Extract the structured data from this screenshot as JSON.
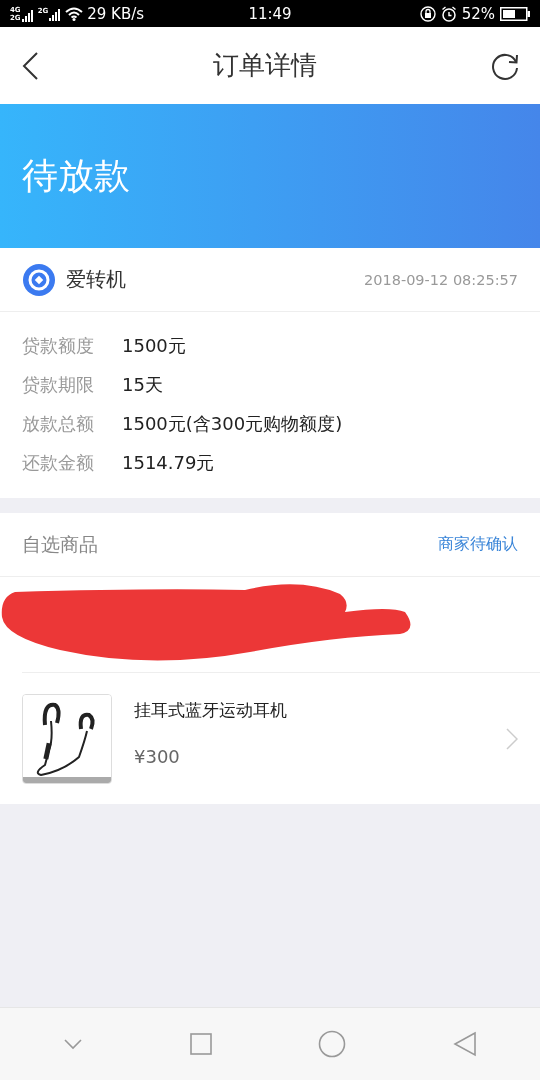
{
  "status_bar": {
    "network_labels": [
      "4G",
      "2G",
      "2G"
    ],
    "speed": "29 KB/s",
    "time": "11:49",
    "battery": "52%"
  },
  "header": {
    "title": "订单详情"
  },
  "banner": {
    "status": "待放款"
  },
  "merchant": {
    "name": "爱转机",
    "time": "2018-09-12 08:25:57"
  },
  "details": [
    {
      "label": "贷款额度",
      "value": "1500元"
    },
    {
      "label": "贷款期限",
      "value": "15天"
    },
    {
      "label": "放款总额",
      "value": "1500元(含300元购物额度)"
    },
    {
      "label": "还款金额",
      "value": "1514.79元"
    }
  ],
  "goods": {
    "title": "自选商品",
    "state": "商家待确认",
    "product": {
      "name": "挂耳式蓝牙运动耳机",
      "price": "¥300"
    }
  }
}
